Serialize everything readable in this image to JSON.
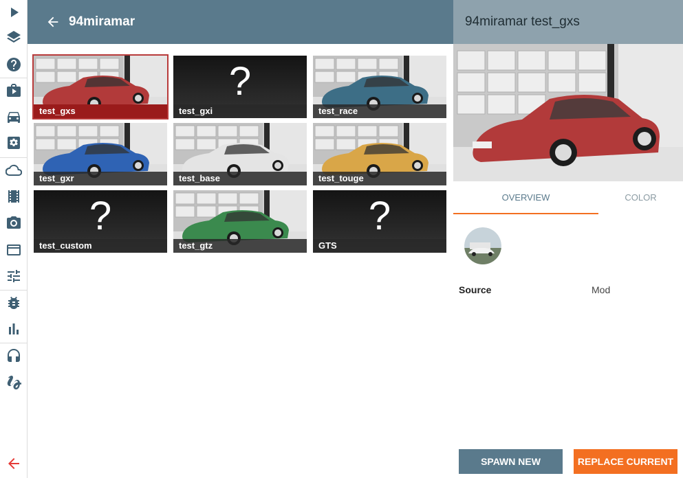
{
  "header": {
    "title": "94miramar"
  },
  "panel": {
    "title": "94miramar test_gxs",
    "tabs": [
      {
        "label": "OVERVIEW",
        "active": true
      },
      {
        "label": "COLOR",
        "active": false
      }
    ],
    "info": {
      "source_label": "Source",
      "source_value": "Mod"
    },
    "buttons": {
      "spawn": "SPAWN NEW",
      "replace": "REPLACE CURRENT"
    }
  },
  "configs": [
    {
      "label": "test_gxs",
      "car_color": "#b23a3a",
      "has_image": true,
      "selected": true
    },
    {
      "label": "test_gxi",
      "has_image": false,
      "placeholder": "?"
    },
    {
      "label": "test_race",
      "car_color": "#3d6e86",
      "has_image": true
    },
    {
      "label": "test_gxr",
      "car_color": "#2f63b4",
      "has_image": true
    },
    {
      "label": "test_base",
      "car_color": "#e4e4e4",
      "has_image": true
    },
    {
      "label": "test_touge",
      "car_color": "#d9a648",
      "has_image": true
    },
    {
      "label": "test_custom",
      "has_image": false,
      "placeholder": "?"
    },
    {
      "label": "test_gtz",
      "car_color": "#3b8a4e",
      "has_image": true
    },
    {
      "label": "GTS",
      "has_image": false,
      "placeholder": "?"
    }
  ],
  "sidebar": {
    "icons": [
      "play-icon",
      "layers-icon",
      "help-icon",
      "scenario-icon",
      "vehicle-icon",
      "settings-icon",
      "cloud-icon",
      "film-icon",
      "camera-icon",
      "window-icon",
      "tune-icon",
      "bug-icon",
      "chart-icon",
      "headphones-icon",
      "gesture-icon",
      "back-icon"
    ]
  },
  "colors": {
    "header": "#5a7a8c",
    "accent": "#f36f21",
    "selected": "#9a1b1b"
  }
}
